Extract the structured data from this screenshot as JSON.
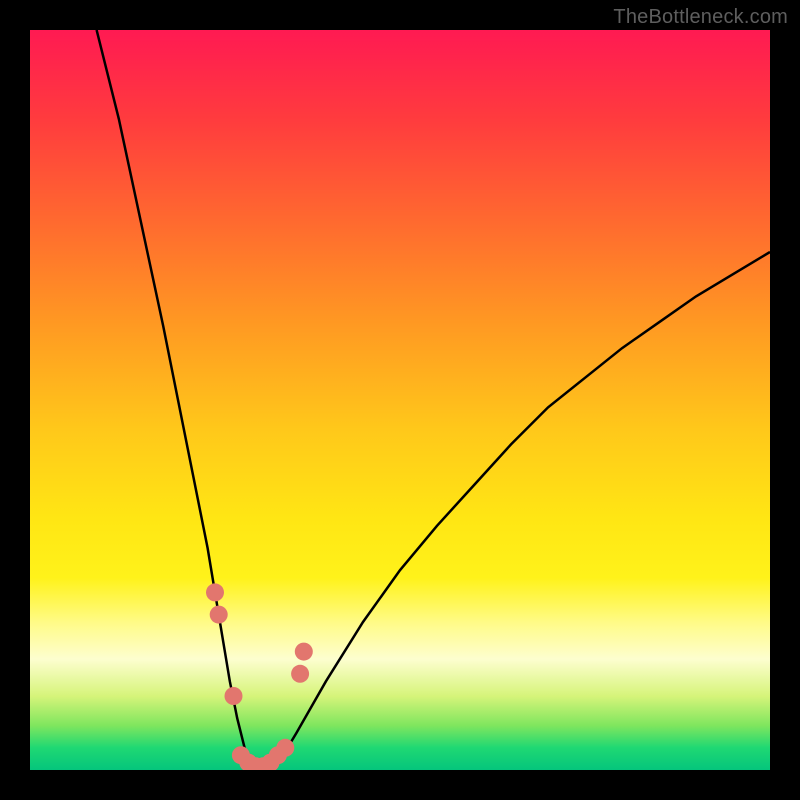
{
  "watermark": {
    "text": "TheBottleneck.com"
  },
  "chart_data": {
    "type": "line",
    "title": "",
    "xlabel": "",
    "ylabel": "",
    "xlim": [
      0,
      100
    ],
    "ylim": [
      0,
      100
    ],
    "grid": false,
    "legend": false,
    "background_gradient_stops": [
      {
        "pct": 0,
        "color": "#ff1a52"
      },
      {
        "pct": 12,
        "color": "#ff3b3e"
      },
      {
        "pct": 26,
        "color": "#ff6a2f"
      },
      {
        "pct": 40,
        "color": "#ff9a22"
      },
      {
        "pct": 54,
        "color": "#ffc81a"
      },
      {
        "pct": 66,
        "color": "#ffe614"
      },
      {
        "pct": 74,
        "color": "#fff21a"
      },
      {
        "pct": 80,
        "color": "#fffb86"
      },
      {
        "pct": 85,
        "color": "#fdfecf"
      },
      {
        "pct": 90,
        "color": "#d6f47a"
      },
      {
        "pct": 94,
        "color": "#7fe65e"
      },
      {
        "pct": 97,
        "color": "#1fd873"
      },
      {
        "pct": 100,
        "color": "#05c57c"
      }
    ],
    "series": [
      {
        "name": "bottleneck-curve",
        "stroke": "#000000",
        "stroke_width": 2.5,
        "x": [
          9,
          12,
          15,
          18,
          20,
          22,
          24,
          25,
          26,
          27,
          28,
          29,
          30,
          31,
          32,
          33,
          34.5,
          36,
          40,
          45,
          50,
          55,
          60,
          65,
          70,
          75,
          80,
          85,
          90,
          95,
          100
        ],
        "y": [
          100,
          88,
          74,
          60,
          50,
          40,
          30,
          24,
          18,
          12,
          7,
          3,
          1,
          0.5,
          0.5,
          1,
          2.5,
          5,
          12,
          20,
          27,
          33,
          38.5,
          44,
          49,
          53,
          57,
          60.5,
          64,
          67,
          70
        ]
      }
    ],
    "markers": {
      "name": "highlight-dots",
      "color": "#e2766e",
      "radius_px": 9,
      "points": [
        {
          "x": 25.0,
          "y": 24
        },
        {
          "x": 25.5,
          "y": 21
        },
        {
          "x": 27.5,
          "y": 10
        },
        {
          "x": 28.5,
          "y": 2
        },
        {
          "x": 29.5,
          "y": 1
        },
        {
          "x": 30.5,
          "y": 0.5
        },
        {
          "x": 31.5,
          "y": 0.5
        },
        {
          "x": 32.5,
          "y": 1
        },
        {
          "x": 33.5,
          "y": 2
        },
        {
          "x": 34.5,
          "y": 3
        },
        {
          "x": 36.5,
          "y": 13
        },
        {
          "x": 37.0,
          "y": 16
        }
      ]
    }
  }
}
